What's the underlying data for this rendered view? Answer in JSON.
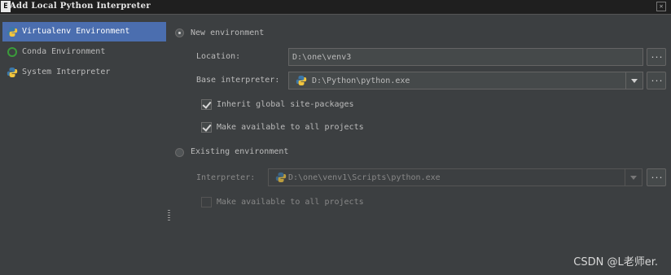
{
  "window": {
    "title": "Add Local Python Interpreter",
    "app_icon": "E",
    "close_glyph": "✕"
  },
  "sidebar": {
    "items": [
      {
        "label": "Virtualenv Environment",
        "icon": "python-icon",
        "selected": true
      },
      {
        "label": "Conda Environment",
        "icon": "conda-icon",
        "selected": false
      },
      {
        "label": "System Interpreter",
        "icon": "python-icon",
        "selected": false
      }
    ]
  },
  "new_env": {
    "radio_label": "New environment",
    "selected": true,
    "location_label": "Location:",
    "location_value": "D:\\one\\venv3",
    "base_label": "Base interpreter:",
    "base_value": "D:\\Python\\python.exe",
    "inherit_label": "Inherit global site-packages",
    "inherit_checked": true,
    "make_available_label": "Make available to all projects",
    "make_available_checked": true
  },
  "existing_env": {
    "radio_label": "Existing environment",
    "selected": false,
    "interpreter_label": "Interpreter:",
    "interpreter_value": "D:\\one\\venv1\\Scripts\\python.exe",
    "make_available_label": "Make available to all projects",
    "make_available_checked": false
  },
  "browse_glyph": "...",
  "watermark": "CSDN @L老师er.",
  "colors": {
    "background": "#3c3f41",
    "selection": "#4b6eaf",
    "field": "#45494a",
    "python_blue": "#3b77a8",
    "python_yellow": "#f2c53d",
    "conda_green": "#3a9b3a"
  }
}
